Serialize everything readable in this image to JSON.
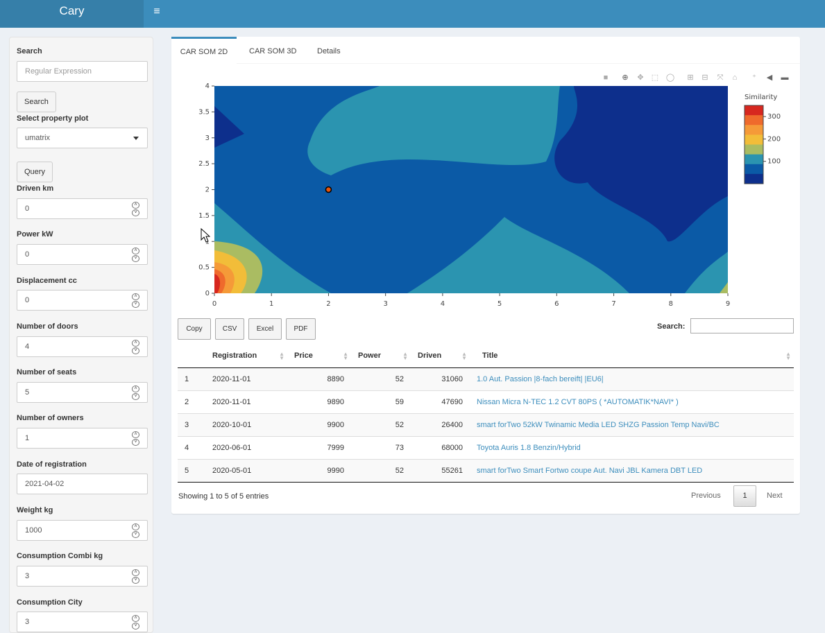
{
  "header": {
    "logo": "Cary",
    "menu_icon": "≡"
  },
  "sidebar": {
    "search_label": "Search",
    "search_placeholder": "Regular Expression",
    "search_button": "Search",
    "property_plot_label": "Select property plot",
    "property_plot_value": "umatrix",
    "query_button": "Query",
    "fields": [
      {
        "label": "Driven km",
        "value": "0"
      },
      {
        "label": "Power kW",
        "value": "0"
      },
      {
        "label": "Displacement cc",
        "value": "0"
      },
      {
        "label": "Number of doors",
        "value": "4"
      },
      {
        "label": "Number of seats",
        "value": "5"
      },
      {
        "label": "Number of owners",
        "value": "1"
      },
      {
        "label": "Date of registration",
        "value": "2021-04-02"
      },
      {
        "label": "Weight kg",
        "value": "1000"
      },
      {
        "label": "Consumption Combi kg",
        "value": "3"
      },
      {
        "label": "Consumption City",
        "value": "3"
      }
    ]
  },
  "tabs": [
    "CAR SOM 2D",
    "CAR SOM 3D",
    "Details"
  ],
  "active_tab": 0,
  "chart_data": {
    "type": "heatmap",
    "title": "",
    "xlabel": "",
    "ylabel": "",
    "xlim": [
      0,
      9
    ],
    "ylim": [
      0,
      4
    ],
    "x_ticks": [
      "0",
      "1",
      "2",
      "3",
      "4",
      "5",
      "6",
      "7",
      "8",
      "9"
    ],
    "y_ticks": [
      "0",
      "0.5",
      "1",
      "1.5",
      "2",
      "2.5",
      "3",
      "3.5",
      "4"
    ],
    "colorbar_title": "Similarity",
    "colorbar_ticks": [
      "100",
      "200",
      "300"
    ],
    "colorscale": [
      "#0d2f8c",
      "#0b5aa6",
      "#2b94b0",
      "#aabc62",
      "#f2bd39",
      "#f59a38",
      "#ef6a2c",
      "#d7271f"
    ],
    "marker": {
      "x": 2,
      "y": 2,
      "color": "#e6550d"
    }
  },
  "table": {
    "buttons": [
      "Copy",
      "CSV",
      "Excel",
      "PDF"
    ],
    "search_label": "Search:",
    "columns": [
      "",
      "Registration",
      "Price",
      "Power",
      "Driven",
      "Title"
    ],
    "rows": [
      [
        "1",
        "2020-11-01",
        "8890",
        "52",
        "31060",
        "1.0 Aut. Passion |8-fach bereift| |EU6|"
      ],
      [
        "2",
        "2020-11-01",
        "9890",
        "59",
        "47690",
        "Nissan Micra N-TEC 1.2 CVT 80PS ( *AUTOMATIK*NAVI* )"
      ],
      [
        "3",
        "2020-10-01",
        "9900",
        "52",
        "26400",
        "smart forTwo 52kW Twinamic Media LED SHZG Passion Temp Navi/BC"
      ],
      [
        "4",
        "2020-06-01",
        "7999",
        "73",
        "68000",
        "Toyota Auris 1.8 Benzin/Hybrid"
      ],
      [
        "5",
        "2020-05-01",
        "9990",
        "52",
        "55261",
        "smart forTwo Smart Fortwo coupe Aut. Navi JBL Kamera DBT LED"
      ]
    ],
    "info": "Showing 1 to 5 of 5 entries",
    "pager": {
      "previous": "Previous",
      "current": "1",
      "next": "Next"
    }
  }
}
